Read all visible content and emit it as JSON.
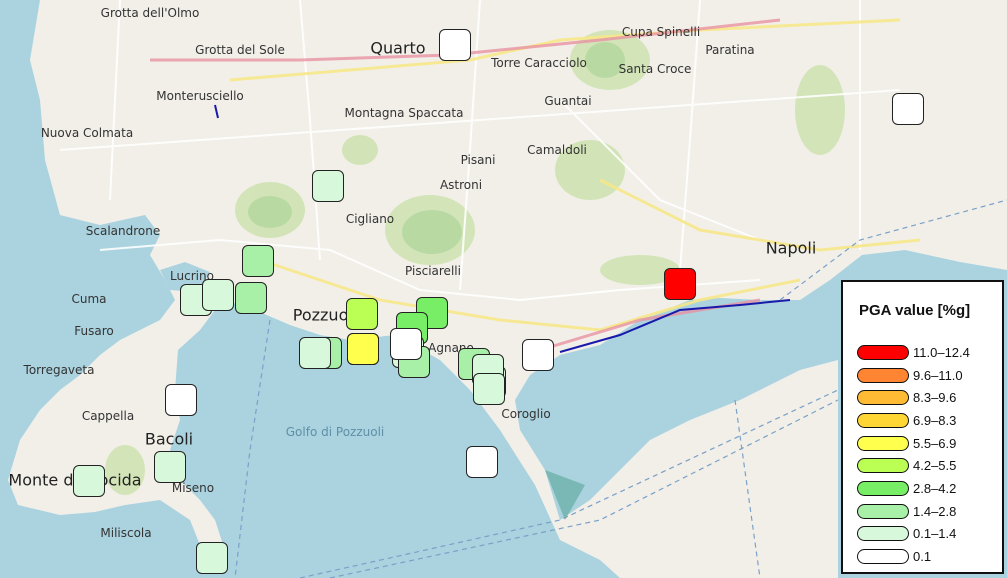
{
  "legend": {
    "title": "PGA value [%g]",
    "classes": [
      {
        "label": "11.0–12.4",
        "color": "#ff0000"
      },
      {
        "label": "9.6–11.0",
        "color": "#ff8533"
      },
      {
        "label": "8.3–9.6",
        "color": "#ffbb33"
      },
      {
        "label": "6.9–8.3",
        "color": "#ffd633"
      },
      {
        "label": "5.5–6.9",
        "color": "#ffff4d"
      },
      {
        "label": "4.2–5.5",
        "color": "#bbff55"
      },
      {
        "label": "2.8–4.2",
        "color": "#77ee66"
      },
      {
        "label": "1.4–2.8",
        "color": "#a8f0a8"
      },
      {
        "label": "0.1–1.4",
        "color": "#d8f8dc"
      },
      {
        "label": "0.1",
        "color": "#ffffff"
      }
    ]
  },
  "map": {
    "water_color": "#aad3df",
    "land_color": "#f2efe9",
    "places": [
      {
        "name": "Grotta dell'Olmo",
        "size": "normal"
      },
      {
        "name": "Grotta del Sole",
        "size": "normal"
      },
      {
        "name": "Quarto",
        "size": "big"
      },
      {
        "name": "Torre Caracciolo",
        "size": "normal"
      },
      {
        "name": "Cupa Spinelli",
        "size": "normal"
      },
      {
        "name": "Paratina",
        "size": "normal"
      },
      {
        "name": "Santa Croce",
        "size": "normal"
      },
      {
        "name": "Monterusciello",
        "size": "normal"
      },
      {
        "name": "Guantai",
        "size": "normal"
      },
      {
        "name": "Montagna Spaccata",
        "size": "normal"
      },
      {
        "name": "Nuova Colmata",
        "size": "normal"
      },
      {
        "name": "Camaldoli",
        "size": "normal"
      },
      {
        "name": "Pisani",
        "size": "normal"
      },
      {
        "name": "Astroni",
        "size": "normal"
      },
      {
        "name": "Cigliano",
        "size": "normal"
      },
      {
        "name": "Scalandrone",
        "size": "normal"
      },
      {
        "name": "Napoli",
        "size": "big"
      },
      {
        "name": "Pisciarelli",
        "size": "normal"
      },
      {
        "name": "Lucrino",
        "size": "normal"
      },
      {
        "name": "Cuma",
        "size": "normal"
      },
      {
        "name": "Pozzuoli",
        "size": "big"
      },
      {
        "name": "Fusaro",
        "size": "normal"
      },
      {
        "name": "Agnano",
        "size": "normal"
      },
      {
        "name": "Torregaveta",
        "size": "normal"
      },
      {
        "name": "Cappella",
        "size": "normal"
      },
      {
        "name": "Coroglio",
        "size": "normal"
      },
      {
        "name": "Bacoli",
        "size": "big"
      },
      {
        "name": "Golfo di Pozzuoli",
        "size": "water"
      },
      {
        "name": "Monte di Procida",
        "size": "big"
      },
      {
        "name": "Miseno",
        "size": "normal"
      },
      {
        "name": "Miliscola",
        "size": "normal"
      }
    ],
    "stations": [
      {
        "pga_class": 9
      },
      {
        "pga_class": 9
      },
      {
        "pga_class": 8
      },
      {
        "pga_class": 7
      },
      {
        "pga_class": 8
      },
      {
        "pga_class": 8
      },
      {
        "pga_class": 7
      },
      {
        "pga_class": 0
      },
      {
        "pga_class": 5
      },
      {
        "pga_class": 7
      },
      {
        "pga_class": 8
      },
      {
        "pga_class": 7
      },
      {
        "pga_class": 6
      },
      {
        "pga_class": 6
      },
      {
        "pga_class": 4
      },
      {
        "pga_class": 8
      },
      {
        "pga_class": 7
      },
      {
        "pga_class": 8
      },
      {
        "pga_class": 7
      },
      {
        "pga_class": 8
      },
      {
        "pga_class": 8
      },
      {
        "pga_class": 9
      },
      {
        "pga_class": 9
      },
      {
        "pga_class": 8
      },
      {
        "pga_class": 8
      },
      {
        "pga_class": 9
      },
      {
        "pga_class": 8
      },
      {
        "pga_class": 9
      }
    ]
  }
}
